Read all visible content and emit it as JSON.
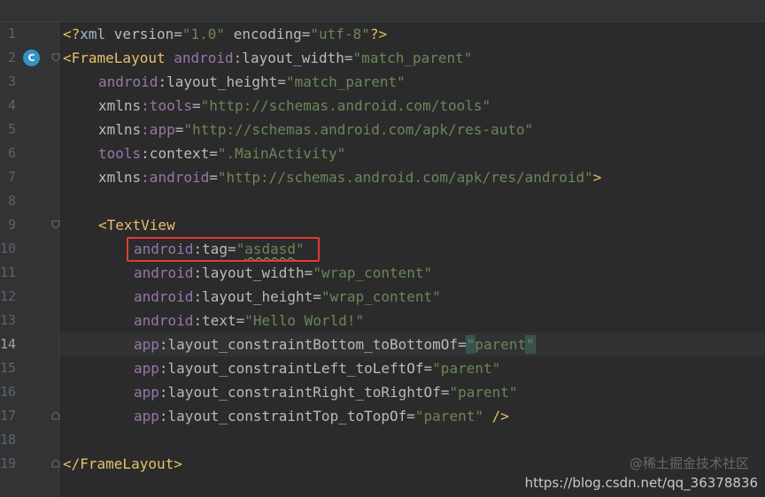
{
  "lines": [
    {
      "n": "1",
      "fold": "",
      "tokens": [
        {
          "c": "t-punc",
          "t": "<?"
        },
        {
          "c": "t-txt",
          "t": "xml "
        },
        {
          "c": "t-attr",
          "t": "version"
        },
        {
          "c": "t-eq",
          "t": "="
        },
        {
          "c": "t-val",
          "t": "\"1.0\""
        },
        {
          "c": "t-txt",
          "t": " "
        },
        {
          "c": "t-attr",
          "t": "encoding"
        },
        {
          "c": "t-eq",
          "t": "="
        },
        {
          "c": "t-val",
          "t": "\"utf-8\""
        },
        {
          "c": "t-punc",
          "t": "?>"
        }
      ]
    },
    {
      "n": "2",
      "fold": "open",
      "marker": "C",
      "tokens": [
        {
          "c": "t-tag",
          "t": "<FrameLayout "
        },
        {
          "c": "t-ns",
          "t": "android"
        },
        {
          "c": "t-attr",
          "t": ":layout_width"
        },
        {
          "c": "t-eq",
          "t": "="
        },
        {
          "c": "t-val",
          "t": "\"match_parent\""
        }
      ]
    },
    {
      "n": "3",
      "fold": "",
      "indent": 1,
      "tokens": [
        {
          "c": "t-ns",
          "t": "android"
        },
        {
          "c": "t-attr",
          "t": ":layout_height"
        },
        {
          "c": "t-eq",
          "t": "="
        },
        {
          "c": "t-val",
          "t": "\"match_parent\""
        }
      ]
    },
    {
      "n": "4",
      "fold": "",
      "indent": 1,
      "tokens": [
        {
          "c": "t-attr",
          "t": "xmlns"
        },
        {
          "c": "t-ns",
          "t": ":tools"
        },
        {
          "c": "t-eq",
          "t": "="
        },
        {
          "c": "t-val",
          "t": "\"http://schemas.android.com/tools\""
        }
      ]
    },
    {
      "n": "5",
      "fold": "",
      "indent": 1,
      "tokens": [
        {
          "c": "t-attr",
          "t": "xmlns"
        },
        {
          "c": "t-ns",
          "t": ":app"
        },
        {
          "c": "t-eq",
          "t": "="
        },
        {
          "c": "t-val",
          "t": "\"http://schemas.android.com/apk/res-auto\""
        }
      ]
    },
    {
      "n": "6",
      "fold": "",
      "indent": 1,
      "tokens": [
        {
          "c": "t-ns",
          "t": "tools"
        },
        {
          "c": "t-attr",
          "t": ":context"
        },
        {
          "c": "t-eq",
          "t": "="
        },
        {
          "c": "t-val",
          "t": "\".MainActivity\""
        }
      ]
    },
    {
      "n": "7",
      "fold": "",
      "indent": 1,
      "tokens": [
        {
          "c": "t-attr",
          "t": "xmlns"
        },
        {
          "c": "t-ns",
          "t": ":android"
        },
        {
          "c": "t-eq",
          "t": "="
        },
        {
          "c": "t-val",
          "t": "\"http://schemas.android.com/apk/res/android\""
        },
        {
          "c": "t-tag",
          "t": ">"
        }
      ]
    },
    {
      "n": "8",
      "fold": "",
      "tokens": []
    },
    {
      "n": "9",
      "fold": "open",
      "indent": 1,
      "tokens": [
        {
          "c": "t-tag",
          "t": "<TextView"
        }
      ]
    },
    {
      "n": "10",
      "fold": "",
      "indent": 2,
      "tokens": [
        {
          "c": "t-ns",
          "t": "android"
        },
        {
          "c": "t-attr",
          "t": ":tag"
        },
        {
          "c": "t-eq",
          "t": "="
        },
        {
          "c": "t-val",
          "t": "\""
        },
        {
          "c": "t-val underline",
          "t": "asdasd"
        },
        {
          "c": "t-val",
          "t": "\""
        }
      ]
    },
    {
      "n": "11",
      "fold": "",
      "indent": 2,
      "tokens": [
        {
          "c": "t-ns",
          "t": "android"
        },
        {
          "c": "t-attr",
          "t": ":layout_width"
        },
        {
          "c": "t-eq",
          "t": "="
        },
        {
          "c": "t-val",
          "t": "\"wrap_content\""
        }
      ]
    },
    {
      "n": "12",
      "fold": "",
      "indent": 2,
      "tokens": [
        {
          "c": "t-ns",
          "t": "android"
        },
        {
          "c": "t-attr",
          "t": ":layout_height"
        },
        {
          "c": "t-eq",
          "t": "="
        },
        {
          "c": "t-val",
          "t": "\"wrap_content\""
        }
      ]
    },
    {
      "n": "13",
      "fold": "",
      "indent": 2,
      "tokens": [
        {
          "c": "t-ns",
          "t": "android"
        },
        {
          "c": "t-attr",
          "t": ":text"
        },
        {
          "c": "t-eq",
          "t": "="
        },
        {
          "c": "t-val",
          "t": "\"Hello World!\""
        }
      ]
    },
    {
      "n": "14",
      "fold": "",
      "current": true,
      "indent": 2,
      "tokens": [
        {
          "c": "t-ns",
          "t": "app"
        },
        {
          "c": "t-attr",
          "t": ":layout_constraintBottom_toBottomOf"
        },
        {
          "c": "t-eq",
          "t": "="
        },
        {
          "c": "t-val caret-hl",
          "t": "\""
        },
        {
          "c": "t-val",
          "t": "parent"
        },
        {
          "c": "t-val caret-hl",
          "t": "\""
        }
      ]
    },
    {
      "n": "15",
      "fold": "",
      "indent": 2,
      "tokens": [
        {
          "c": "t-ns",
          "t": "app"
        },
        {
          "c": "t-attr",
          "t": ":layout_constraintLeft_toLeftOf"
        },
        {
          "c": "t-eq",
          "t": "="
        },
        {
          "c": "t-val",
          "t": "\"parent\""
        }
      ]
    },
    {
      "n": "16",
      "fold": "",
      "indent": 2,
      "tokens": [
        {
          "c": "t-ns",
          "t": "app"
        },
        {
          "c": "t-attr",
          "t": ":layout_constraintRight_toRightOf"
        },
        {
          "c": "t-eq",
          "t": "="
        },
        {
          "c": "t-val",
          "t": "\"parent\""
        }
      ]
    },
    {
      "n": "17",
      "fold": "close",
      "indent": 2,
      "tokens": [
        {
          "c": "t-ns",
          "t": "app"
        },
        {
          "c": "t-attr",
          "t": ":layout_constraintTop_toTopOf"
        },
        {
          "c": "t-eq",
          "t": "="
        },
        {
          "c": "t-val",
          "t": "\"parent\""
        },
        {
          "c": "t-tag",
          "t": " />"
        }
      ]
    },
    {
      "n": "18",
      "fold": "",
      "tokens": []
    },
    {
      "n": "19",
      "fold": "close",
      "tokens": [
        {
          "c": "t-tag",
          "t": "</FrameLayout>"
        }
      ]
    }
  ],
  "watermark": {
    "primary": "https://blog.csdn.net/qq_36378836",
    "secondary": "@稀土掘金技术社区"
  }
}
